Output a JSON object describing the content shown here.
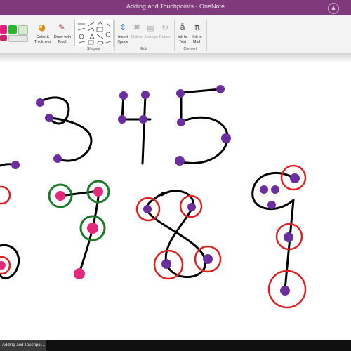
{
  "window": {
    "title": "Adding and Touchpoints - OneNote"
  },
  "ribbon": {
    "buttons": [
      {
        "id": "color-thickness",
        "label": "Color &\nThickness",
        "enabled": true
      },
      {
        "id": "draw-with-touch",
        "label": "Draw with\nTouch",
        "enabled": true
      },
      {
        "id": "insert-space",
        "label": "Insert\nSpace",
        "enabled": true
      },
      {
        "id": "delete",
        "label": "Delete",
        "enabled": false
      },
      {
        "id": "arrange",
        "label": "Arrange",
        "enabled": false
      },
      {
        "id": "rotate",
        "label": "Rotate",
        "enabled": false
      },
      {
        "id": "ink-to-text",
        "label": "Ink to\nText",
        "enabled": true
      },
      {
        "id": "ink-to-math",
        "label": "Ink to\nMath",
        "enabled": true
      }
    ],
    "groups": [
      {
        "id": "shapes",
        "label": "Shapes"
      },
      {
        "id": "edit",
        "label": "Edit"
      },
      {
        "id": "convert",
        "label": "Convert"
      }
    ],
    "pen_colors": [
      "#e41a7c",
      "#2bb52b",
      "#d8ead0"
    ]
  },
  "ink_colors": {
    "black": "#000000",
    "purple": "#6b2ea1",
    "pink": "#e5287a",
    "red": "#e02020",
    "green": "#1b7a2a"
  },
  "taskbar": {
    "item_label": "Adding and Touchpoi..."
  }
}
